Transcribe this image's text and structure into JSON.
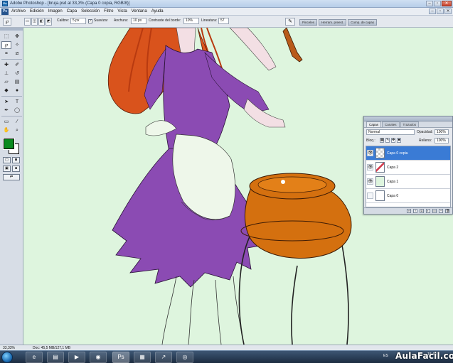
{
  "window": {
    "title": "Adobe Photoshop - [bruja.psd al 33,3% (Capa 0 copia, RGB/8)]"
  },
  "menubar": {
    "logo": "Ps",
    "items": [
      "Archivo",
      "Edición",
      "Imagen",
      "Capa",
      "Selección",
      "Filtro",
      "Vista",
      "Ventana",
      "Ayuda"
    ]
  },
  "options": {
    "caliber_label": "Calibre:",
    "caliber_value": "5 px",
    "smooth_label": "Suavizar",
    "width_label": "Anchura:",
    "width_value": "10 px",
    "edge_contrast_label": "Contraste del borde:",
    "edge_contrast_value": "10%",
    "lineature_label": "Lineatura:",
    "lineature_value": "57",
    "panel_wells": [
      "Pinceles",
      "Herram. preest.",
      "Comp. de capas"
    ]
  },
  "colors": {
    "foreground": "#0a8a1f",
    "background": "#ffffff",
    "canvas_background": "#def5de"
  },
  "layers_panel": {
    "tabs": [
      "Capas",
      "Canales",
      "Trazados"
    ],
    "blend_mode": "Normal",
    "opacity_label": "Opacidad:",
    "opacity_value": "100%",
    "lock_label": "Bloq.:",
    "fill_label": "Relleno:",
    "fill_value": "100%",
    "layers": [
      {
        "name": "Capa 0 copia",
        "visible": true,
        "selected": true
      },
      {
        "name": "Capa 2",
        "visible": true,
        "selected": false
      },
      {
        "name": "Capa 1",
        "visible": true,
        "selected": false
      },
      {
        "name": "Capa 0",
        "visible": false,
        "selected": false
      }
    ]
  },
  "statusbar": {
    "zoom": "33,33%",
    "doc": "Doc: 45,5 MB/127,1 MB"
  },
  "taskbar": {
    "language": "ES",
    "time": "18:40",
    "watermark": "AulaFacil.com"
  }
}
